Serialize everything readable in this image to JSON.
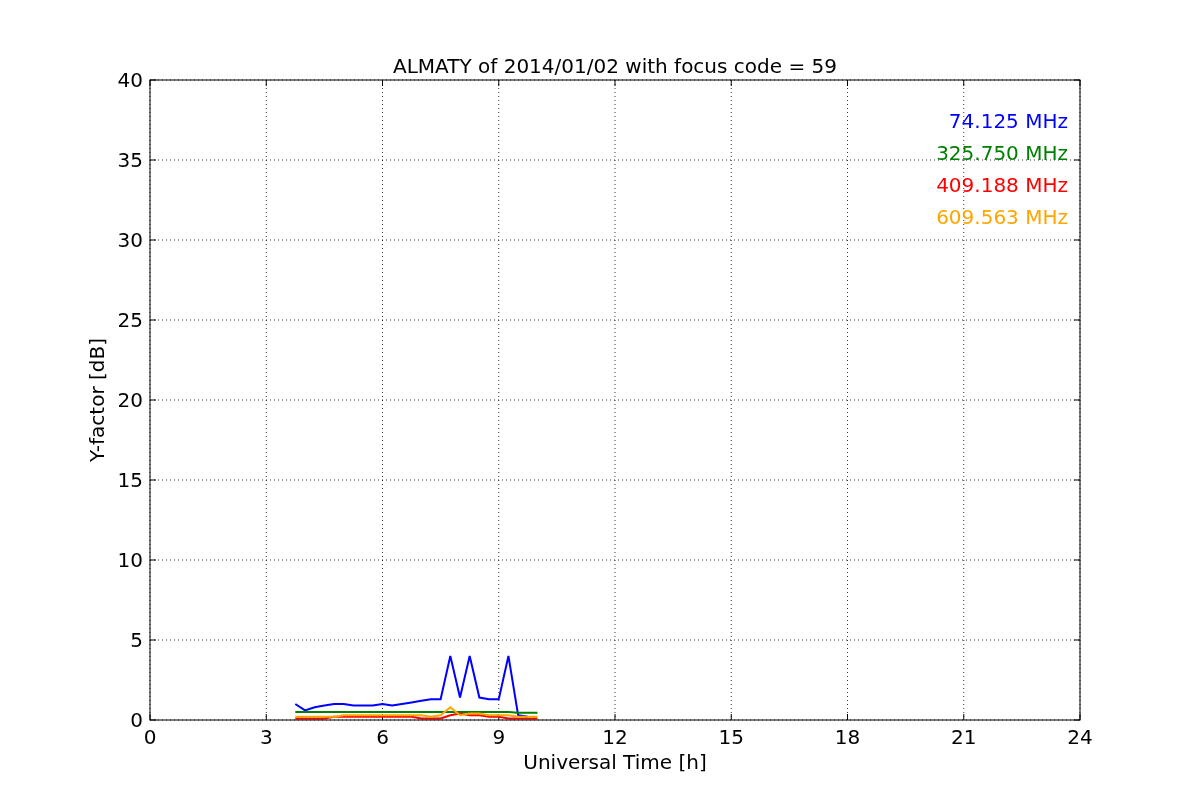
{
  "figure": {
    "chart_data": {
      "type": "line",
      "title": "ALMATY of 2014/01/02 with focus code = 59",
      "xlabel": "Universal Time [h]",
      "ylabel": "Y-factor [dB]",
      "x": [
        3.75,
        4,
        4.25,
        4.5,
        4.75,
        5,
        5.25,
        5.5,
        5.75,
        6,
        6.25,
        6.5,
        6.75,
        7,
        7.25,
        7.5,
        7.75,
        8,
        8.25,
        8.5,
        8.75,
        9,
        9.25,
        9.5,
        9.75,
        10
      ],
      "series": [
        {
          "name": "74.125 MHz",
          "color": "#0000ff",
          "values": [
            1.0,
            0.6,
            0.8,
            0.9,
            1.0,
            1.0,
            0.9,
            0.9,
            0.9,
            1.0,
            0.9,
            1.0,
            1.1,
            1.2,
            1.3,
            1.3,
            4.0,
            1.4,
            4.0,
            1.4,
            1.3,
            1.3,
            4.0,
            0.3,
            0.2,
            null
          ]
        },
        {
          "name": "325.750 MHz",
          "color": "#008000",
          "values": [
            0.5,
            0.5,
            0.5,
            0.5,
            0.5,
            0.5,
            0.5,
            0.5,
            0.5,
            0.5,
            0.5,
            0.5,
            0.5,
            0.5,
            0.5,
            0.5,
            0.5,
            0.5,
            0.5,
            0.5,
            0.5,
            0.5,
            0.5,
            0.45,
            0.45,
            0.45
          ]
        },
        {
          "name": "409.188 MHz",
          "color": "#ff0000",
          "values": [
            0.1,
            0.1,
            0.1,
            0.1,
            0.2,
            0.2,
            0.2,
            0.2,
            0.2,
            0.2,
            0.2,
            0.2,
            0.2,
            0.1,
            0.1,
            0.1,
            0.3,
            0.4,
            0.3,
            0.3,
            0.2,
            0.2,
            0.1,
            0.1,
            0.1,
            0.1
          ]
        },
        {
          "name": "609.563 MHz",
          "color": "#ffa500",
          "values": [
            0.2,
            0.2,
            0.2,
            0.2,
            0.2,
            0.3,
            0.3,
            0.3,
            0.3,
            0.3,
            0.3,
            0.3,
            0.3,
            0.3,
            0.2,
            0.3,
            0.8,
            0.3,
            0.4,
            0.4,
            0.3,
            0.3,
            0.3,
            0.2,
            0.2,
            0.2
          ]
        }
      ],
      "grid": true,
      "xlim": [
        0,
        24
      ],
      "ylim": [
        0,
        40
      ],
      "xticks": [
        0,
        3,
        6,
        9,
        12,
        15,
        18,
        21,
        24
      ],
      "yticks": [
        0,
        5,
        10,
        15,
        20,
        25,
        30,
        35,
        40
      ]
    }
  }
}
